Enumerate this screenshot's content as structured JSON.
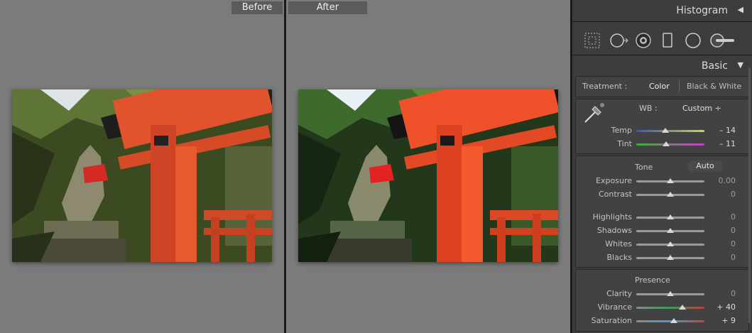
{
  "compare": {
    "before_label": "Before",
    "after_label": "After",
    "photo_subject": "torii-gate-with-fox-statue"
  },
  "panel": {
    "histogram_title": "Histogram",
    "histogram_arrow": "◀",
    "basic_title": "Basic",
    "basic_arrow": "▼",
    "tools": [
      "crop-overlay-icon",
      "spot-removal-icon",
      "red-eye-icon",
      "graduated-filter-icon",
      "radial-filter-icon",
      "adjustment-brush-icon"
    ],
    "treatment": {
      "label": "Treatment :",
      "color": "Color",
      "bw": "Black & White"
    },
    "wb": {
      "label": "WB :",
      "value": "Custom ÷"
    },
    "temp": {
      "label": "Temp",
      "value": "– 14",
      "pos": 0.43
    },
    "tint": {
      "label": "Tint",
      "value": "– 11",
      "pos": 0.44
    },
    "tone": {
      "title": "Tone",
      "auto": "Auto"
    },
    "exposure": {
      "label": "Exposure",
      "value": "0.00",
      "pos": 0.5
    },
    "contrast": {
      "label": "Contrast",
      "value": "0",
      "pos": 0.5
    },
    "highlights": {
      "label": "Highlights",
      "value": "0",
      "pos": 0.5
    },
    "shadows": {
      "label": "Shadows",
      "value": "0",
      "pos": 0.5
    },
    "whites": {
      "label": "Whites",
      "value": "0",
      "pos": 0.5
    },
    "blacks": {
      "label": "Blacks",
      "value": "0",
      "pos": 0.5
    },
    "presence": {
      "title": "Presence"
    },
    "clarity": {
      "label": "Clarity",
      "value": "0",
      "pos": 0.5
    },
    "vibrance": {
      "label": "Vibrance",
      "value": "+ 40",
      "pos": 0.68
    },
    "saturation": {
      "label": "Saturation",
      "value": "+ 9",
      "pos": 0.55
    }
  },
  "colors": {
    "panel_bg": "#3d3d3d",
    "workspace_bg": "#7b7b7b",
    "torii_red": "#e4502a"
  }
}
